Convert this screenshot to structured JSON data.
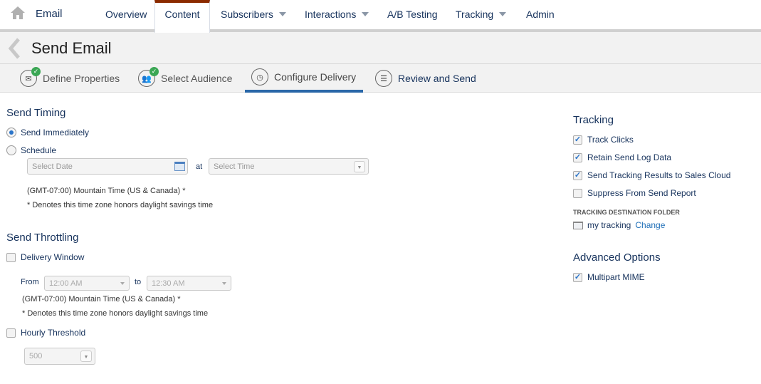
{
  "nav": {
    "home_icon": "home-icon",
    "app_title": "Email",
    "items": [
      {
        "label": "Overview",
        "dropdown": false
      },
      {
        "label": "Content",
        "dropdown": false,
        "active": true
      },
      {
        "label": "Subscribers",
        "dropdown": true
      },
      {
        "label": "Interactions",
        "dropdown": true
      },
      {
        "label": "A/B Testing",
        "dropdown": false
      },
      {
        "label": "Tracking",
        "dropdown": true
      },
      {
        "label": "Admin",
        "dropdown": false
      }
    ],
    "active_color": "#8b2a00"
  },
  "header": {
    "title": "Send Email"
  },
  "steps": [
    {
      "label": "Define Properties",
      "complete": true
    },
    {
      "label": "Select Audience",
      "complete": true
    },
    {
      "label": "Configure Delivery",
      "active": true
    },
    {
      "label": "Review and Send"
    }
  ],
  "send_timing": {
    "title": "Send Timing",
    "send_immediately": "Send Immediately",
    "schedule": "Schedule",
    "selected": "Send Immediately",
    "date_placeholder": "Select Date",
    "at": "at",
    "time_placeholder": "Select Time",
    "timezone": "(GMT-07:00) Mountain Time (US & Canada) *",
    "dst_note": "* Denotes this time zone honors daylight savings time"
  },
  "throttling": {
    "title": "Send Throttling",
    "delivery_window": "Delivery Window",
    "delivery_window_checked": false,
    "from": "From",
    "from_value": "12:00 AM",
    "to": "to",
    "to_value": "12:30 AM",
    "timezone": "(GMT-07:00) Mountain Time (US & Canada) *",
    "dst_note": "* Denotes this time zone honors daylight savings time",
    "hourly_threshold": "Hourly Threshold",
    "hourly_threshold_checked": false,
    "threshold_value": "500"
  },
  "tracking": {
    "title": "Tracking",
    "options": [
      {
        "label": "Track Clicks",
        "checked": true
      },
      {
        "label": "Retain Send Log Data",
        "checked": true
      },
      {
        "label": "Send Tracking Results to Sales Cloud",
        "checked": true
      },
      {
        "label": "Suppress From Send Report",
        "checked": false
      }
    ],
    "folder_heading": "TRACKING DESTINATION FOLDER",
    "folder_name": "my tracking",
    "change_link": "Change"
  },
  "advanced": {
    "title": "Advanced Options",
    "options": [
      {
        "label": "Multipart MIME",
        "checked": true
      }
    ]
  }
}
